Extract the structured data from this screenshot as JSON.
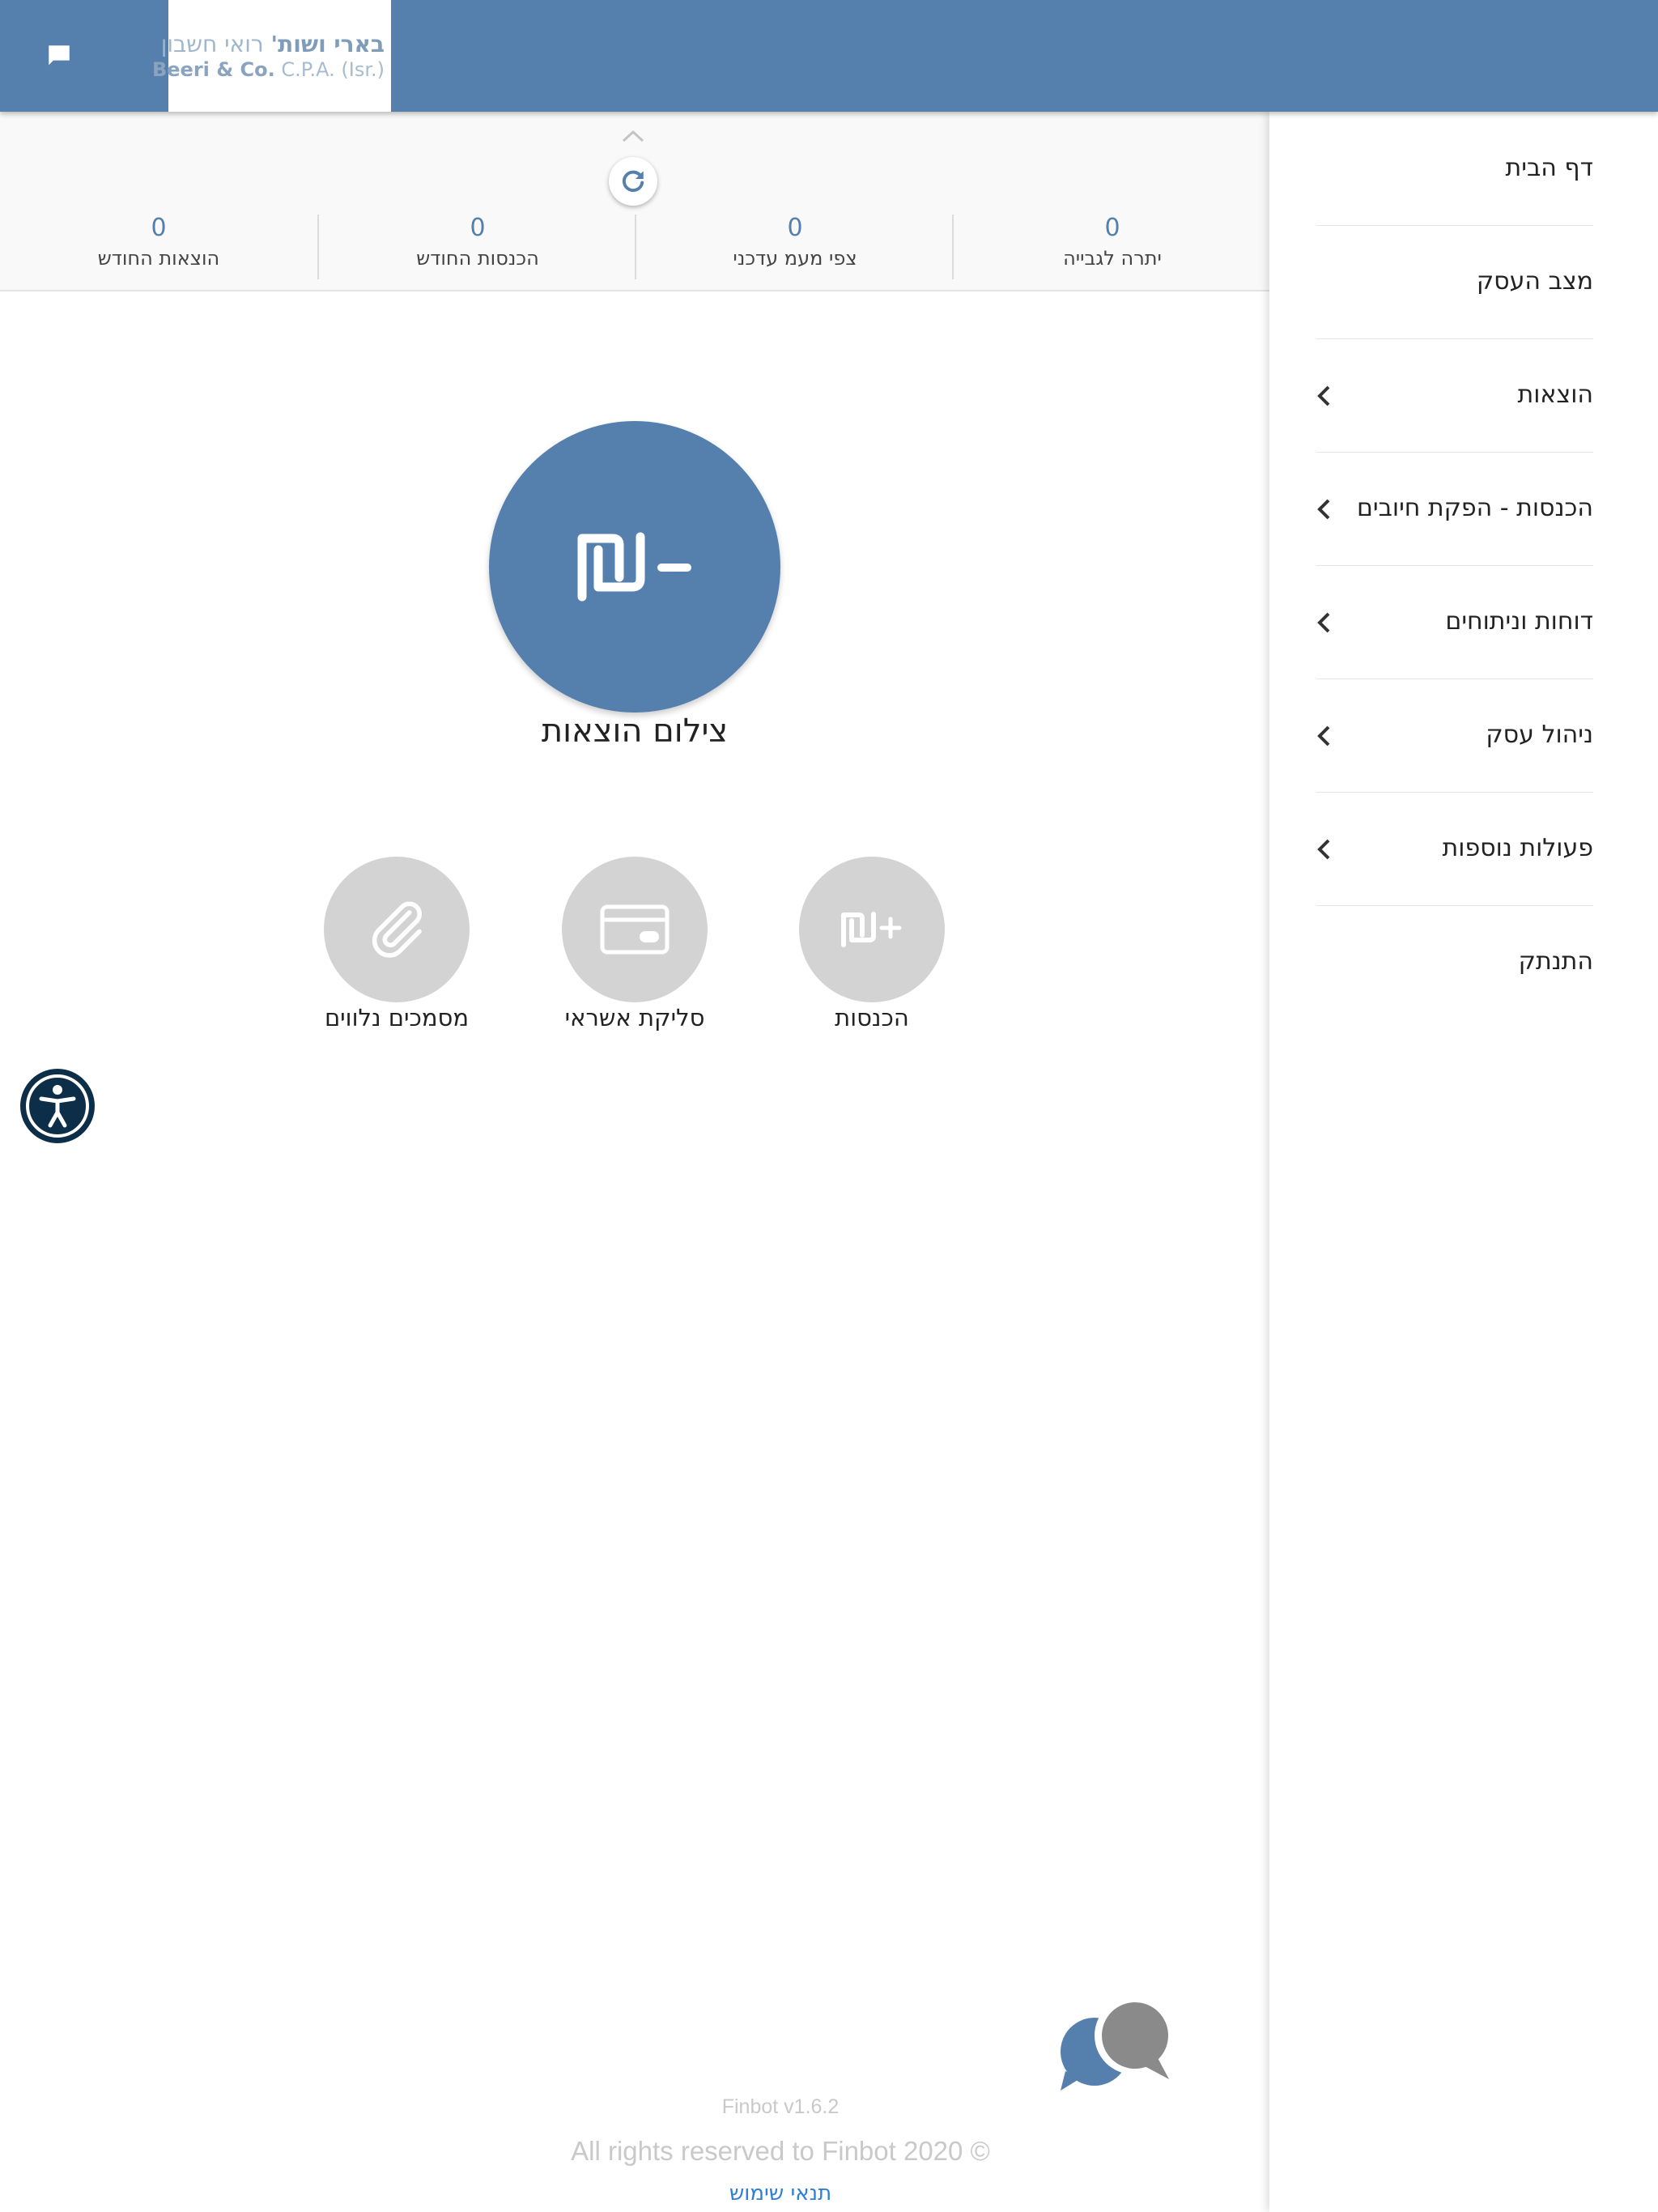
{
  "header": {
    "logo": {
      "line1_bold": "בארי ושות'",
      "line1": "רואי חשבון",
      "line2_bold": "Beeri & Co.",
      "line2": "C.P.A. (Isr.)"
    },
    "chat_icon": "chat-icon",
    "color": "#5580ad"
  },
  "sidebar": {
    "items": [
      {
        "label": "דף הבית",
        "has_submenu": false
      },
      {
        "label": "מצב העסק",
        "has_submenu": false
      },
      {
        "label": "הוצאות",
        "has_submenu": true
      },
      {
        "label": "הכנסות - הפקת חיובים",
        "has_submenu": true
      },
      {
        "label": "דוחות וניתוחים",
        "has_submenu": true
      },
      {
        "label": "ניהול עסק",
        "has_submenu": true
      },
      {
        "label": "פעולות נוספות",
        "has_submenu": true
      },
      {
        "label": "התנתק",
        "has_submenu": false
      }
    ]
  },
  "stats": [
    {
      "label": "הוצאות החודש",
      "value": "0"
    },
    {
      "label": "הכנסות החודש",
      "value": "0"
    },
    {
      "label": "צפי מעמ עדכני",
      "value": "0"
    },
    {
      "label": "יתרה לגבייה",
      "value": "0"
    }
  ],
  "main_action": {
    "label": "צילום הוצאות",
    "icon": "shekel-minus-icon"
  },
  "sub_actions": [
    {
      "label": "מסמכים נלווים",
      "icon": "paperclip-icon"
    },
    {
      "label": "סליקת אשראי",
      "icon": "credit-card-icon"
    },
    {
      "label": "הכנסות",
      "icon": "shekel-plus-icon"
    }
  ],
  "footer": {
    "version": "Finbot v1.6.2",
    "rights": "All rights reserved to Finbot 2020 ©",
    "terms": "תנאי שימוש"
  },
  "colors": {
    "accent": "#5580ad",
    "grey_button": "#d3d3d3",
    "link": "#2f7ed8",
    "accessibility": "#0d2e48"
  }
}
